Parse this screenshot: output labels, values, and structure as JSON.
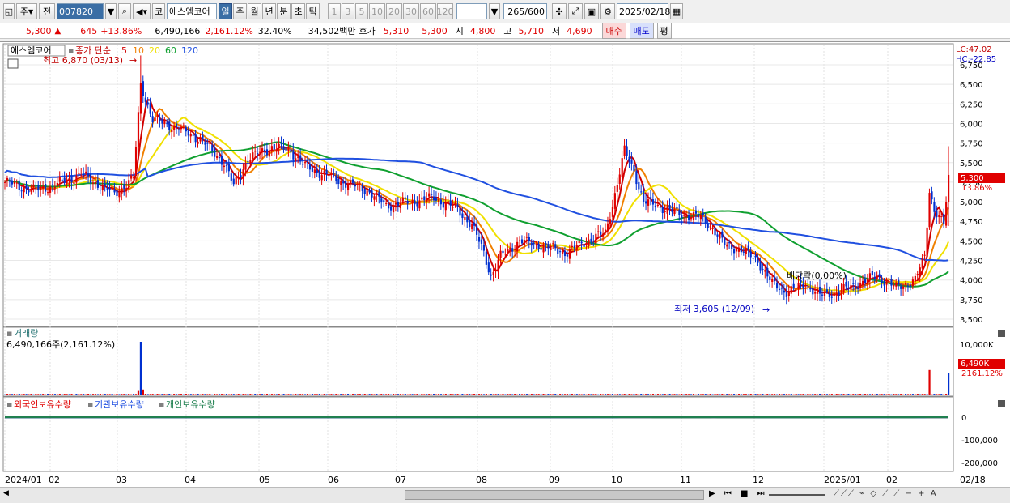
{
  "toolbar": {
    "type_btn": "주",
    "prev_btn": "전",
    "code": "007820",
    "search_icon": "search-icon",
    "sound_icon": "speaker-icon",
    "market": "코",
    "name": "에스엠코어",
    "periods": [
      "일",
      "주",
      "월",
      "년",
      "분",
      "초",
      "틱"
    ],
    "selected_period": "일",
    "intervals": [
      "1",
      "3",
      "5",
      "10",
      "20",
      "30",
      "60",
      "120"
    ],
    "count": "265",
    "total": "/600",
    "date": "2025/02/18"
  },
  "quote": {
    "price": "5,300",
    "arrow": "▲",
    "change": "645",
    "rate": "+13.86%",
    "volume": "6,490,166",
    "vol_ratio": "2,161.12%",
    "turnover": "32.40%",
    "amount": "34,502백만",
    "hoga_label": "호가",
    "hoga1": "5,310",
    "hoga2": "5,300",
    "open_label": "시",
    "open": "4,800",
    "high_label": "고",
    "high": "5,710",
    "low_label": "저",
    "low": "4,690",
    "buy": "매수",
    "sell": "매도",
    "avg": "평"
  },
  "main_panel": {
    "name": "에스엠코어",
    "ma_title": "종가 단순",
    "ma_periods": [
      "5",
      "10",
      "20",
      "60",
      "120"
    ],
    "ma_colors": [
      "#d00000",
      "#f08000",
      "#f0e000",
      "#10a030",
      "#2050e0"
    ],
    "high_note": "최고 6,870 (03/13)",
    "low_note": "최저 3,605 (12/09)",
    "div_note": "배당락(0.00%)",
    "lc": "LC:47.02",
    "hc": "HC:-22.85",
    "price_tag": "5,300",
    "rate_tag": "13.86%",
    "yticks": [
      "6,750",
      "6,500",
      "6,250",
      "6,000",
      "5,750",
      "5,500",
      "5,250",
      "5,000",
      "4,750",
      "4,500",
      "4,250",
      "4,000",
      "3,750",
      "3,500"
    ]
  },
  "volume_panel": {
    "title": "거래량",
    "value": "6,490,166주(2,161.12%)",
    "tick": "10,000K",
    "tag_vol": "6,490K",
    "tag_pct": "2161.12%"
  },
  "investor_panel": {
    "titles": [
      "외국인보유수량",
      "기관보유수량",
      "개인보유수량"
    ],
    "colors": [
      "#e00000",
      "#2050e0",
      "#208050"
    ],
    "ticks": [
      "0",
      "-100,000",
      "-200,000"
    ]
  },
  "xaxis": {
    "labels": [
      "2024/01",
      "02",
      "03",
      "04",
      "05",
      "06",
      "07",
      "08",
      "09",
      "10",
      "11",
      "12",
      "2025/01",
      "02",
      "02/18"
    ]
  },
  "chart_data": {
    "type": "candlestick",
    "price_axis": {
      "min": 3500,
      "max": 6750,
      "step": 250
    },
    "high_point": {
      "date": "03/13",
      "value": 6870
    },
    "low_point": {
      "date": "12/09",
      "value": 3605
    },
    "last": {
      "open": 4800,
      "high": 5710,
      "low": 4690,
      "close": 5300
    },
    "close_path": [
      [
        0,
        5250
      ],
      [
        12,
        5150
      ],
      [
        20,
        5200
      ],
      [
        32,
        5350
      ],
      [
        46,
        5100
      ],
      [
        54,
        5300
      ],
      [
        57,
        6500
      ],
      [
        62,
        6050
      ],
      [
        72,
        5950
      ],
      [
        82,
        5800
      ],
      [
        92,
        5500
      ],
      [
        96,
        5200
      ],
      [
        102,
        5550
      ],
      [
        112,
        5700
      ],
      [
        120,
        5650
      ],
      [
        126,
        5450
      ],
      [
        134,
        5350
      ],
      [
        142,
        5250
      ],
      [
        152,
        5150
      ],
      [
        160,
        4950
      ],
      [
        170,
        5000
      ],
      [
        180,
        5050
      ],
      [
        190,
        4900
      ],
      [
        196,
        4700
      ],
      [
        201,
        4350
      ],
      [
        204,
        4050
      ],
      [
        208,
        4300
      ],
      [
        216,
        4500
      ],
      [
        224,
        4450
      ],
      [
        236,
        4350
      ],
      [
        244,
        4500
      ],
      [
        252,
        4600
      ],
      [
        256,
        5100
      ],
      [
        260,
        5650
      ],
      [
        264,
        5400
      ],
      [
        268,
        5000
      ],
      [
        274,
        4950
      ],
      [
        282,
        4850
      ],
      [
        292,
        4800
      ],
      [
        296,
        4700
      ],
      [
        302,
        4450
      ],
      [
        308,
        4400
      ],
      [
        316,
        4250
      ],
      [
        322,
        3950
      ],
      [
        328,
        3850
      ],
      [
        336,
        3950
      ],
      [
        342,
        3800
      ],
      [
        350,
        3850
      ],
      [
        358,
        3950
      ],
      [
        366,
        4050
      ],
      [
        374,
        3900
      ],
      [
        382,
        4000
      ],
      [
        386,
        4300
      ],
      [
        388,
        5150
      ],
      [
        390,
        4900
      ],
      [
        394,
        4700
      ],
      [
        396,
        5300
      ]
    ],
    "volume_spikes": [
      {
        "date": "03/13",
        "value_k": 11000
      },
      {
        "date": "02/12",
        "value_k": 5200
      },
      {
        "date": "02/18",
        "value_k": 4500
      }
    ]
  }
}
